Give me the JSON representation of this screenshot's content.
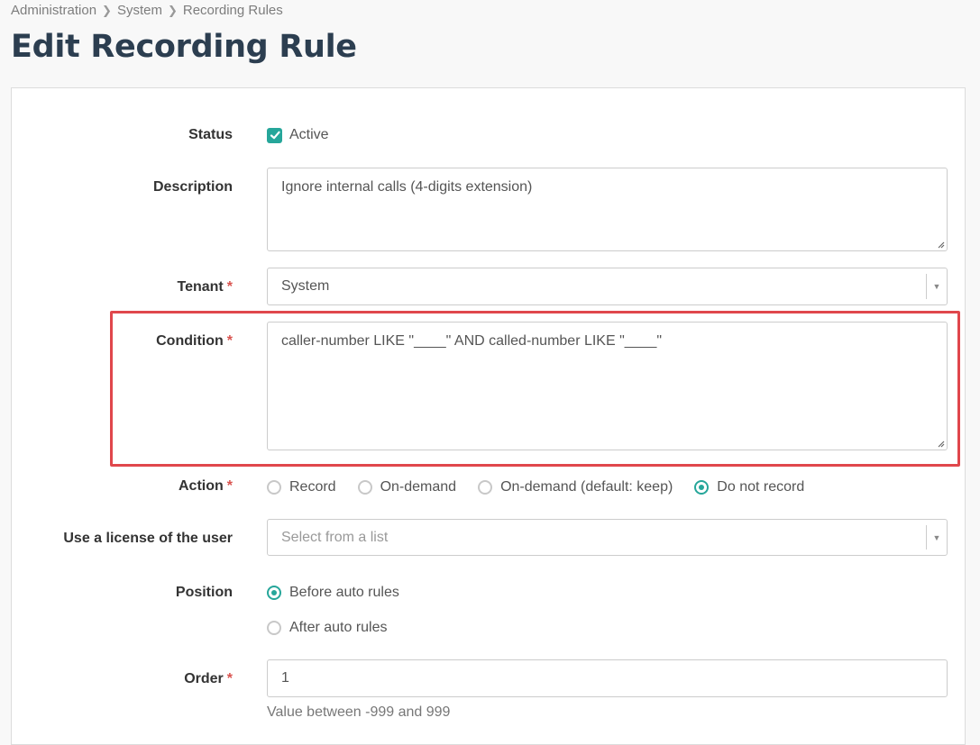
{
  "breadcrumb": {
    "items": [
      "Administration",
      "System",
      "Recording Rules"
    ]
  },
  "page": {
    "title": "Edit Recording Rule"
  },
  "form": {
    "status": {
      "label": "Status",
      "checkbox_label": "Active",
      "checked": true
    },
    "description": {
      "label": "Description",
      "value": "Ignore internal calls (4-digits extension)"
    },
    "tenant": {
      "label": "Tenant",
      "required_mark": "*",
      "value": "System"
    },
    "condition": {
      "label": "Condition",
      "required_mark": "*",
      "value": "caller-number LIKE \"____\" AND called-number LIKE \"____\""
    },
    "action": {
      "label": "Action",
      "required_mark": "*",
      "options": [
        "Record",
        "On-demand",
        "On-demand (default: keep)",
        "Do not record"
      ],
      "selected": "Do not record"
    },
    "license": {
      "label": "Use a license of the user",
      "placeholder": "Select from a list"
    },
    "position": {
      "label": "Position",
      "options": [
        "Before auto rules",
        "After auto rules"
      ],
      "selected": "Before auto rules"
    },
    "order": {
      "label": "Order",
      "required_mark": "*",
      "value": "1",
      "hint": "Value between -999 and 999"
    }
  },
  "colors": {
    "accent": "#26a69a",
    "required": "#d9534f",
    "highlight": "#e0474c",
    "title": "#2c3e50"
  }
}
